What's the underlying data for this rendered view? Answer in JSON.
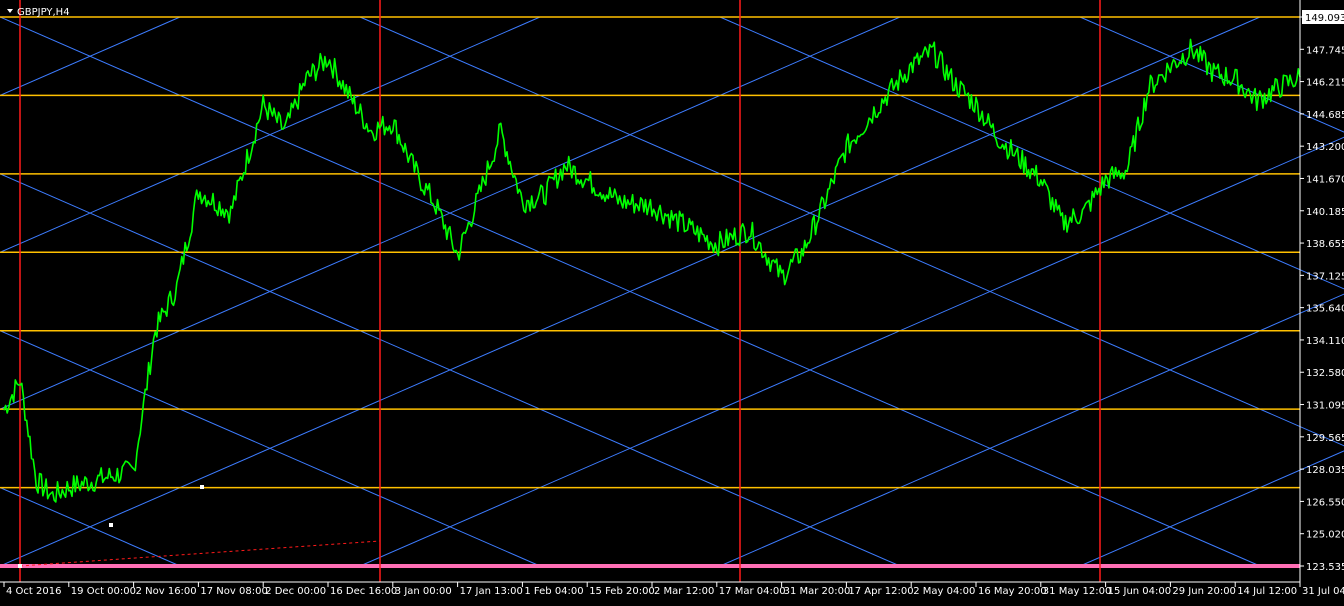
{
  "chart_title": "GBPJPY,H4",
  "current_price_label": "149.093",
  "colors": {
    "background": "#000000",
    "candles": "#00ff00",
    "gann_lines": "#3d7cff",
    "horizontal_levels": "#ffc000",
    "vertical_lines": "#ff1a1a",
    "base_level": "#ff6fb5",
    "axis_text": "#ffffff"
  },
  "chart_data": {
    "type": "line",
    "title": "GBPJPY,H4",
    "xlabel": "",
    "ylabel": "",
    "ylim": [
      123.535,
      149.093
    ],
    "grid": false,
    "y_ticks": [
      "149.093",
      "147.745",
      "146.215",
      "144.685",
      "143.200",
      "141.670",
      "140.185",
      "138.655",
      "137.125",
      "135.640",
      "134.110",
      "132.580",
      "131.095",
      "129.565",
      "128.035",
      "126.550",
      "125.020",
      "123.535"
    ],
    "x_ticks": [
      "4 Oct 2016",
      "19 Oct 00:00",
      "2 Nov 16:00",
      "17 Nov 08:00",
      "2 Dec 00:00",
      "16 Dec 16:00",
      "3 Jan 00:00",
      "17 Jan 13:00",
      "1 Feb 04:00",
      "15 Feb 20:00",
      "2 Mar 12:00",
      "17 Mar 04:00",
      "31 Mar 20:00",
      "17 Apr 12:00",
      "2 May 04:00",
      "16 May 20:00",
      "31 May 12:00",
      "15 Jun 04:00",
      "29 Jun 20:00",
      "14 Jul 12:00",
      "31 Jul 04:00"
    ],
    "series": [
      {
        "x": [
          "4 Oct 2016",
          "6 Oct 2016",
          "10 Oct 2016",
          "14 Oct 2016",
          "19 Oct 00:00",
          "25 Oct 2016",
          "2 Nov 16:00",
          "5 Nov 2016",
          "10 Nov 2016",
          "17 Nov 08:00",
          "22 Nov 2016",
          "2 Dec 00:00",
          "6 Dec 2016",
          "10 Dec 2016",
          "16 Dec 16:00",
          "20 Dec 2016",
          "26 Dec 2016",
          "3 Jan 00:00",
          "7 Jan 2017",
          "12 Jan 2017",
          "17 Jan 13:00",
          "20 Jan 2017",
          "25 Jan 2017",
          "1 Feb 04:00",
          "5 Feb 2017",
          "10 Feb 2017",
          "15 Feb 20:00",
          "22 Feb 2017",
          "2 Mar 12:00",
          "10 Mar 2017",
          "17 Mar 04:00",
          "24 Mar 2017",
          "31 Mar 20:00",
          "5 Apr 2017",
          "10 Apr 2017",
          "17 Apr 12:00",
          "22 Apr 2017",
          "2 May 04:00",
          "6 May 2017",
          "10 May 2017",
          "16 May 20:00",
          "22 May 2017",
          "26 May 2017",
          "31 May 12:00",
          "4 Jun 2017",
          "8 Jun 2017",
          "15 Jun 04:00",
          "20 Jun 2017",
          "25 Jun 2017",
          "29 Jun 20:00",
          "5 Jul 2017",
          "9 Jul 2017",
          "14 Jul 12:00",
          "20 Jul 2017",
          "25 Jul 2017",
          "31 Jul 04:00"
        ],
        "values": [
          130.8,
          132.2,
          127.5,
          126.8,
          127.2,
          127.6,
          128.0,
          134.5,
          136.5,
          141.0,
          140.0,
          145.0,
          143.8,
          146.2,
          147.2,
          145.4,
          143.8,
          144.2,
          142.0,
          140.3,
          138.0,
          140.8,
          143.8,
          140.5,
          140.8,
          142.2,
          141.5,
          140.5,
          140.3,
          139.4,
          138.5,
          139.2,
          137.0,
          138.2,
          140.5,
          143.0,
          145.0,
          146.8,
          147.5,
          146.0,
          145.0,
          143.5,
          142.5,
          141.5,
          139.5,
          140.0,
          141.5,
          142.0,
          145.8,
          146.8,
          147.6,
          146.5,
          146.2,
          145.2,
          145.8,
          146.3
        ]
      }
    ]
  }
}
